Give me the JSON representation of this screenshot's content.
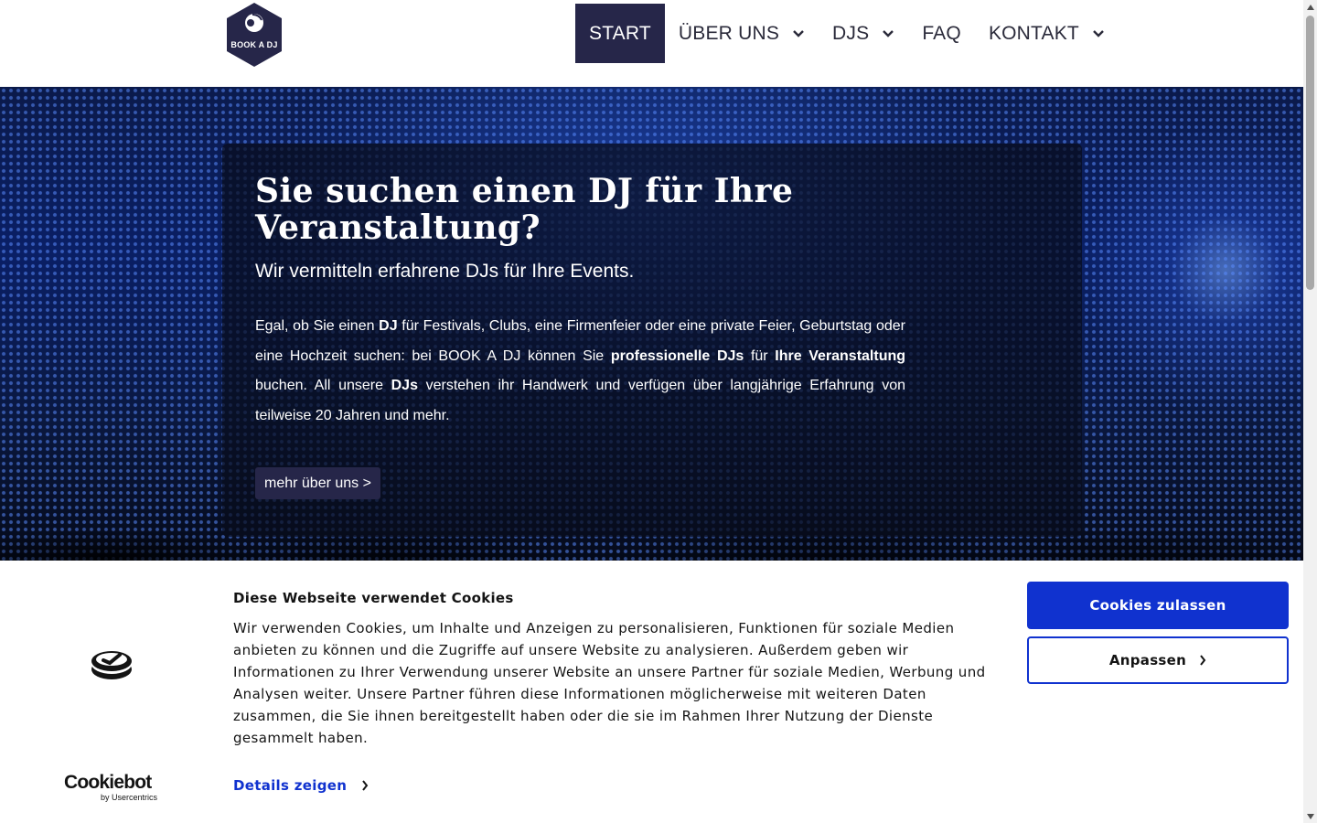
{
  "header": {
    "logo_text": "BOOK A DJ",
    "nav": [
      {
        "label": "START",
        "active": true,
        "dropdown": false
      },
      {
        "label": "ÜBER UNS",
        "active": false,
        "dropdown": true
      },
      {
        "label": "DJS",
        "active": false,
        "dropdown": true
      },
      {
        "label": "FAQ",
        "active": false,
        "dropdown": false
      },
      {
        "label": "KONTAKT",
        "active": false,
        "dropdown": true
      }
    ]
  },
  "hero": {
    "title": "Sie suchen einen DJ für Ihre Veranstaltung?",
    "subtitle": "Wir vermitteln erfahrene DJs für Ihre Events.",
    "body": [
      {
        "text": "Egal, ob Sie einen ",
        "bold": false
      },
      {
        "text": "DJ",
        "bold": true
      },
      {
        "text": " für Festivals, Clubs, eine Firmenfeier oder eine private Feier, Geburtstag oder eine Hochzeit suchen: bei BOOK A DJ können Sie ",
        "bold": false
      },
      {
        "text": "professionelle DJs",
        "bold": true
      },
      {
        "text": " für ",
        "bold": false
      },
      {
        "text": "Ihre Veranstaltung",
        "bold": true
      },
      {
        "text": " buchen. All unsere ",
        "bold": false
      },
      {
        "text": "DJs",
        "bold": true
      },
      {
        "text": " verstehen ihr Handwerk und verfügen über langjährige Erfahrung von teilweise 20 Jahren und mehr.",
        "bold": false
      }
    ],
    "button_label": "mehr über uns >"
  },
  "cookie_banner": {
    "heading": "Diese Webseite verwendet Cookies",
    "text": "Wir verwenden Cookies, um Inhalte und Anzeigen zu personalisieren, Funktionen für soziale Medien anbieten zu können und die Zugriffe auf unsere Website zu analysieren. Außerdem geben wir Informationen zu Ihrer Verwendung unserer Website an unsere Partner für soziale Medien, Werbung und Analysen weiter. Unsere Partner führen diese Informationen möglicherweise mit weiteren Daten zusammen, die Sie ihnen bereitgestellt haben oder die sie im Rahmen Ihrer Nutzung der Dienste gesammelt haben.",
    "details_label": "Details zeigen",
    "allow_label": "Cookies zulassen",
    "customize_label": "Anpassen",
    "brand": "Cookiebot",
    "brand_sub": "by Usercentrics"
  },
  "colors": {
    "nav_active_bg": "#262649",
    "primary_blue": "#1032cf",
    "text_dark": "#141414"
  },
  "icons": {
    "logo": "record-disc-hexagon-icon",
    "dropdown": "chevron-down-icon",
    "cookie": "cookie-stack-icon",
    "arrow": "chevron-right-icon"
  }
}
